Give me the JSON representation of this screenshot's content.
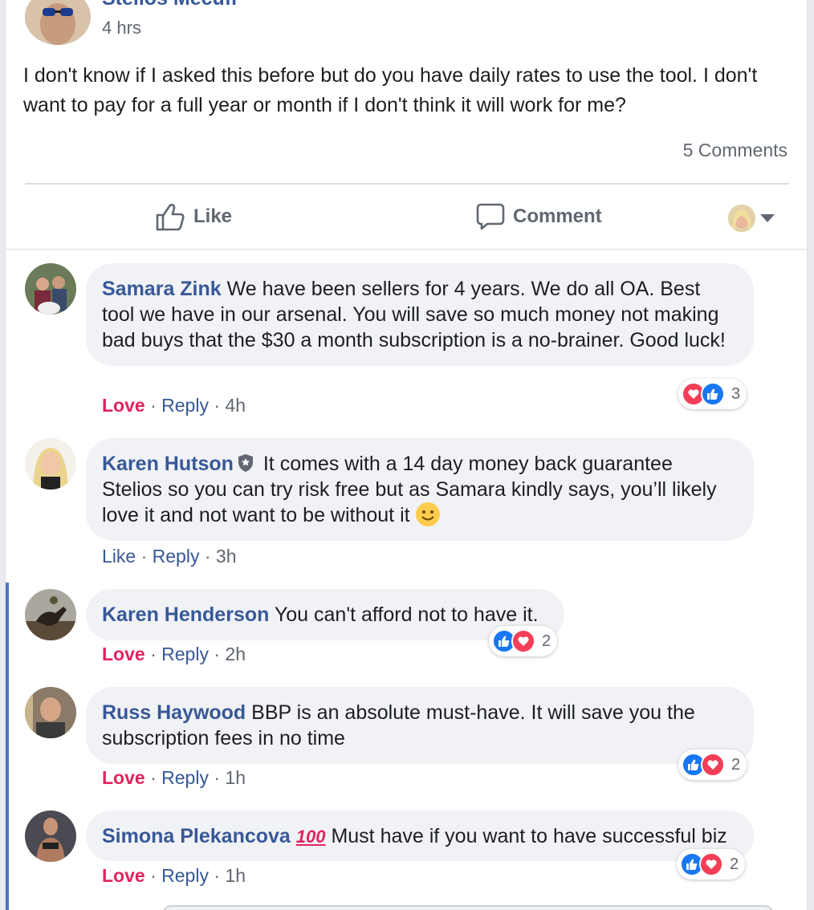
{
  "post": {
    "author": "Stelios Mecufi",
    "time": "4 hrs",
    "text": "I don't know if I asked this before but do you have daily rates to use the tool. I don't want to pay for a full year or month if I don't think it will work for me?",
    "comments_count": "5 Comments"
  },
  "actions": {
    "like": "Like",
    "comment": "Comment"
  },
  "comments": [
    {
      "name": "Samara Zink",
      "text": "We have been sellers for 4 years. We do all OA. Best tool we have in our arsenal. You will save so much money not making bad buys that the $30 a month subscription is a no-brainer. Good luck!",
      "reaction_label": "Love",
      "reply": "Reply",
      "time": "4h",
      "reaction_count": "3"
    },
    {
      "name": "Karen Hutson",
      "text": "It comes with a 14 day money back guarantee Stelios so you can try risk free but as Samara kindly says, you’ll likely love it and not want to be without it",
      "reaction_label": "Like",
      "reply": "Reply",
      "time": "3h"
    },
    {
      "name": "Karen Henderson",
      "text": "You can't afford not to have it.",
      "reaction_label": "Love",
      "reply": "Reply",
      "time": "2h",
      "reaction_count": "2"
    },
    {
      "name": "Russ Haywood",
      "text": "BBP is an absolute must-have. It will save you the subscription fees in no time",
      "reaction_label": "Love",
      "reply": "Reply",
      "time": "1h",
      "reaction_count": "2"
    },
    {
      "name": "Simona Plekancova",
      "badge": "100",
      "text": "Must have if you want to have successful biz",
      "reaction_label": "Love",
      "reply": "Reply",
      "time": "1h",
      "reaction_count": "2"
    }
  ],
  "sep": " · ",
  "colors": {
    "link": "#385898",
    "love": "#e0245e",
    "like_reaction": "#1877f2",
    "love_reaction": "#f33e58",
    "thread_bar": "#4a76c9"
  }
}
